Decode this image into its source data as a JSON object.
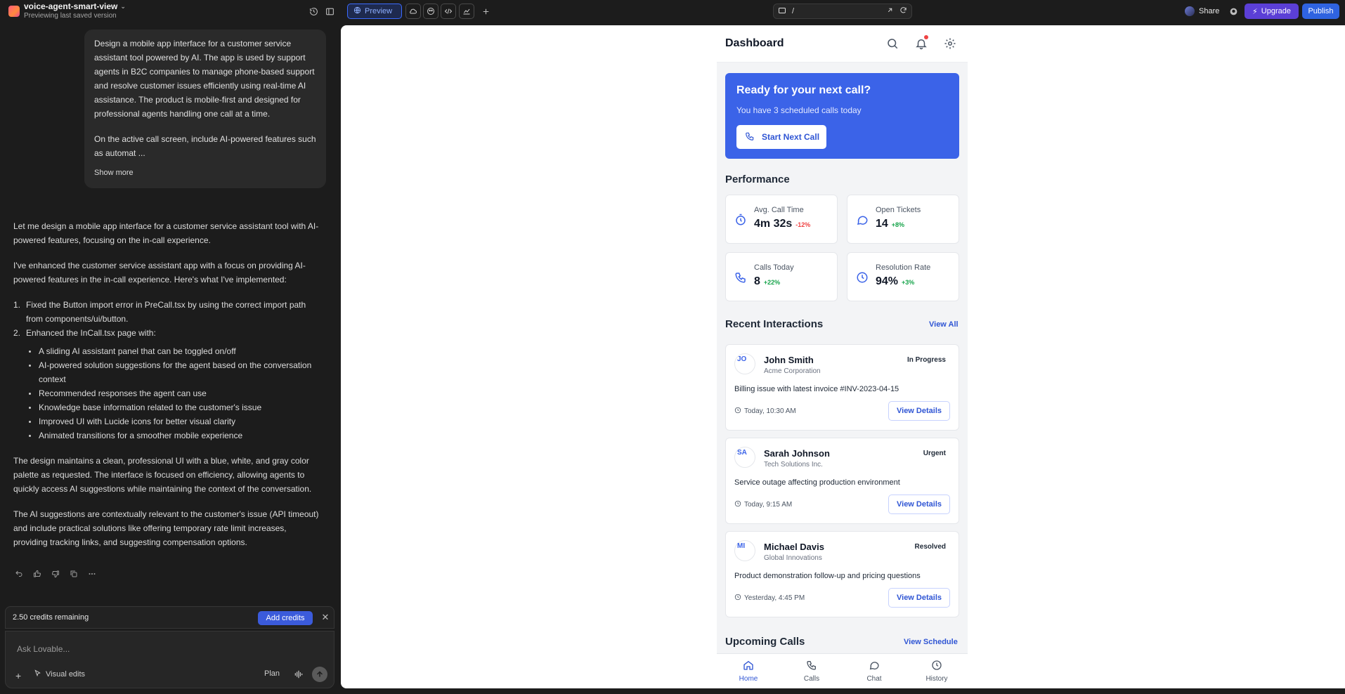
{
  "project": {
    "name": "voice-agent-smart-view",
    "subtitle": "Previewing last saved version"
  },
  "toolbar": {
    "preview_label": "Preview",
    "url_path": "/",
    "share_label": "Share",
    "upgrade_label": "Upgrade",
    "publish_label": "Publish"
  },
  "chat": {
    "user_message": {
      "paragraph1": "Design a mobile app interface for a customer service assistant tool powered by AI. The app is used by support agents in B2C companies to manage phone-based support and resolve customer issues efficiently using real-time AI assistance. The product is mobile-first and designed for professional agents handling one call at a time.",
      "paragraph2": "On the active call screen, include AI-powered features such as automat ...",
      "show_more": "Show more"
    },
    "assistant": {
      "p1": "Let me design a mobile app interface for a customer service assistant tool with AI-powered features, focusing on the in-call experience.",
      "p2": "I've enhanced the customer service assistant app with a focus on providing AI-powered features in the in-call experience. Here's what I've implemented:",
      "steps": [
        {
          "num": "1.",
          "text": "Fixed the Button import error in PreCall.tsx by using the correct import path from components/ui/button."
        },
        {
          "num": "2.",
          "text": "Enhanced the InCall.tsx page with:"
        }
      ],
      "bullets": [
        "A sliding AI assistant panel that can be toggled on/off",
        "AI-powered solution suggestions for the agent based on the conversation context",
        "Recommended responses the agent can use",
        "Knowledge base information related to the customer's issue",
        "Improved UI with Lucide icons for better visual clarity",
        "Animated transitions for a smoother mobile experience"
      ],
      "p3": "The design maintains a clean, professional UI with a blue, white, and gray color palette as requested. The interface is focused on efficiency, allowing agents to quickly access AI suggestions while maintaining the context of the conversation.",
      "p4": "The AI suggestions are contextually relevant to the customer's issue (API timeout) and include practical solutions like offering temporary rate limit increases, providing tracking links, and suggesting compensation options."
    },
    "credits_text": "2.50 credits remaining",
    "add_credits_label": "Add credits",
    "composer_placeholder": "Ask Lovable...",
    "visual_edits_label": "Visual edits",
    "plan_label": "Plan"
  },
  "app": {
    "title": "Dashboard",
    "hero": {
      "title": "Ready for your next call?",
      "subtitle": "You have 3 scheduled calls today",
      "button": "Start Next Call"
    },
    "performance_title": "Performance",
    "stats": [
      {
        "label": "Avg. Call Time",
        "value": "4m 32s",
        "delta": "-12%",
        "trend": "neg",
        "icon": "timer-icon"
      },
      {
        "label": "Open Tickets",
        "value": "14",
        "delta": "+8%",
        "trend": "pos",
        "icon": "message-icon"
      },
      {
        "label": "Calls Today",
        "value": "8",
        "delta": "+22%",
        "trend": "pos",
        "icon": "phone-icon"
      },
      {
        "label": "Resolution Rate",
        "value": "94%",
        "delta": "+3%",
        "trend": "pos",
        "icon": "clock-icon"
      }
    ],
    "recent_title": "Recent Interactions",
    "view_all": "View All",
    "interactions": [
      {
        "initials": "JO",
        "name": "John Smith",
        "company": "Acme Corporation",
        "status": "In Progress",
        "issue": "Billing issue with latest invoice #INV-2023-04-15",
        "time": "Today, 10:30 AM",
        "button": "View Details"
      },
      {
        "initials": "SA",
        "name": "Sarah Johnson",
        "company": "Tech Solutions Inc.",
        "status": "Urgent",
        "issue": "Service outage affecting production environment",
        "time": "Today, 9:15 AM",
        "button": "View Details"
      },
      {
        "initials": "MI",
        "name": "Michael Davis",
        "company": "Global Innovations",
        "status": "Resolved",
        "issue": "Product demonstration follow-up and pricing questions",
        "time": "Yesterday, 4:45 PM",
        "button": "View Details"
      }
    ],
    "upcoming_title": "Upcoming Calls",
    "view_schedule": "View Schedule",
    "nav": [
      {
        "label": "Home",
        "icon": "home-icon",
        "active": true
      },
      {
        "label": "Calls",
        "icon": "phone-icon",
        "active": false
      },
      {
        "label": "Chat",
        "icon": "chat-icon",
        "active": false
      },
      {
        "label": "History",
        "icon": "history-icon",
        "active": false
      }
    ]
  },
  "colors": {
    "accent": "#3b63e8",
    "publish": "#2f63e0",
    "upgrade": "#5b3fd6",
    "positive": "#16a34a",
    "negative": "#ef4444"
  }
}
